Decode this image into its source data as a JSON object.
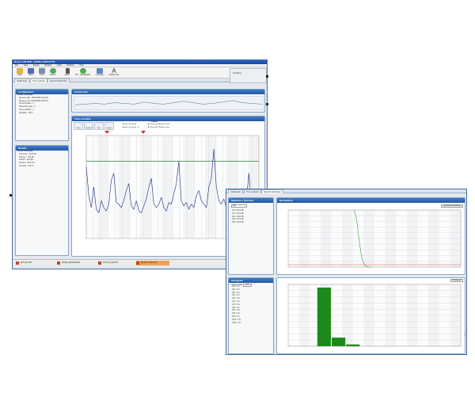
{
  "window1": {
    "title": "Noise LAB 2023 - [NOIS_ETECO.PT]",
    "menu": [
      "File",
      "View",
      "Events",
      "Window",
      "Tools",
      "Weather",
      "Help"
    ],
    "toolbar": [
      {
        "label": "Open",
        "icon": "folder-icon"
      },
      {
        "label": "Save",
        "icon": "save-icon"
      },
      {
        "label": "Print",
        "icon": "printer-icon"
      },
      {
        "label": "Export",
        "icon": "export-icon"
      },
      {
        "label": "Meter",
        "icon": "meter-icon"
      },
      {
        "label": "3D - Visualization",
        "icon": "visualization-icon"
      },
      {
        "label": "Company",
        "icon": "company-icon"
      },
      {
        "label": "Global note",
        "icon": "text-icon"
      }
    ],
    "company_label": "Company :",
    "tabs": [
      "Global data",
      "Time evolution",
      "Spectral distribution"
    ],
    "configuration": {
      "title": "Configuration",
      "group": "Period / Envelope",
      "rows": [
        "Measure start : 06/15/2005 16:22:30",
        "Measure end : 06/15/2005 16:50:40",
        "Period duration : 0",
        "Observation type : 0",
        "Time resolution : 1",
        "Sampling : 1/32 s"
      ]
    },
    "results": {
      "title": "Results",
      "group": "Period / Envelope",
      "rows": [
        "LCeq max : 108.8 dB",
        "LAFmax : 73.8 dB",
        "LAFmin : 46.8 dB",
        "Duration : 00:27:10",
        "Overload : 0.00 %"
      ]
    },
    "global_view": {
      "title": "Global view"
    },
    "time_evolution": {
      "title": "Time evolution",
      "legend_title": "Legend",
      "legend": [
        "Noise Envelope",
        "Noise Envelope Lp",
        "Threshold / Absolute value",
        "Threshold / Relative value"
      ],
      "buttons": [
        "Reset",
        "Threshold",
        "Stats",
        "Events"
      ]
    },
    "statusbar": [
      "EPS_001.N07",
      "NOISE_RECORD.N05",
      "STYLUS_301.PTE",
      "SELECT_0001.DAT"
    ],
    "colors": {
      "header": "#2d64c8",
      "trace": "#1a237e",
      "threshold": "#2e7d32",
      "marker": "#d32f2f"
    }
  },
  "window2": {
    "tabs": [
      "Global data",
      "Time evolution",
      "Spectral distribution"
    ],
    "bottom_label": "Histogram",
    "statistics": {
      "title": "Statistics / Function",
      "field_label": "Lp5",
      "rows": [
        "L01 = 84.6 dB",
        "L10 = 60.5 dB",
        "L50 = 49.8 dB",
        "L90 = 47.6 dB",
        "L95 = 46.9 dB"
      ]
    },
    "histogram_config": {
      "title": "Histogram",
      "field_label": "Classes width",
      "field_value": "0.5",
      "rows": [
        "L45 : 0 %",
        "L50 : 0 %",
        "L55 : 0 %",
        "L60 : 0 %",
        "L65 : 0 %",
        "L70 : 0 %",
        "L75 : 0 %",
        "L80 : 0 %",
        "L85 : 0 %",
        "L90 : 0 %",
        "L95 : 0 %",
        "L100 : 0 %",
        "L105 : 0 %"
      ]
    },
    "distribution": {
      "title": "Distribution",
      "side_label": "Cumulative distribution"
    },
    "histogram_chart": {
      "title": "Histogram"
    },
    "colors": {
      "header": "#2d64c8",
      "bar": "#1b8a1b",
      "curve": "#2e9e2e",
      "ref_line": "#e05050"
    }
  },
  "chart_data": [
    {
      "type": "line",
      "series": [
        {
          "values": [
            49,
            50,
            51,
            50,
            52,
            51,
            50,
            53,
            51,
            50,
            52,
            54,
            52,
            50,
            51,
            53,
            55,
            52,
            51,
            50
          ]
        }
      ]
    },
    {
      "type": "line",
      "y": [
        82,
        65,
        58,
        70,
        57,
        55,
        62,
        58,
        56,
        60,
        74,
        78,
        61,
        60,
        58,
        62,
        68,
        72,
        59,
        57,
        62,
        56,
        55,
        59,
        63,
        70,
        75,
        60,
        58,
        60,
        64,
        58,
        56,
        61,
        60,
        66,
        72,
        85,
        62,
        59,
        61,
        57,
        60,
        58,
        65,
        68,
        62,
        60,
        58,
        70,
        75,
        92,
        70,
        62,
        60,
        63,
        58,
        57,
        66,
        62,
        61,
        58,
        60,
        64,
        62,
        78,
        60,
        58,
        60,
        61
      ],
      "threshold": 85,
      "ylim": [
        40,
        100
      ]
    },
    {
      "type": "line",
      "values": [
        100,
        96,
        88,
        75,
        58,
        42,
        28,
        17,
        10,
        5,
        2,
        1,
        0,
        0,
        0,
        0
      ],
      "ylim": [
        0,
        100
      ]
    },
    {
      "type": "bar",
      "values": [
        0,
        0,
        95,
        14,
        3,
        0,
        0,
        0,
        0,
        0,
        0,
        0
      ],
      "ylim": [
        0,
        100
      ]
    }
  ]
}
